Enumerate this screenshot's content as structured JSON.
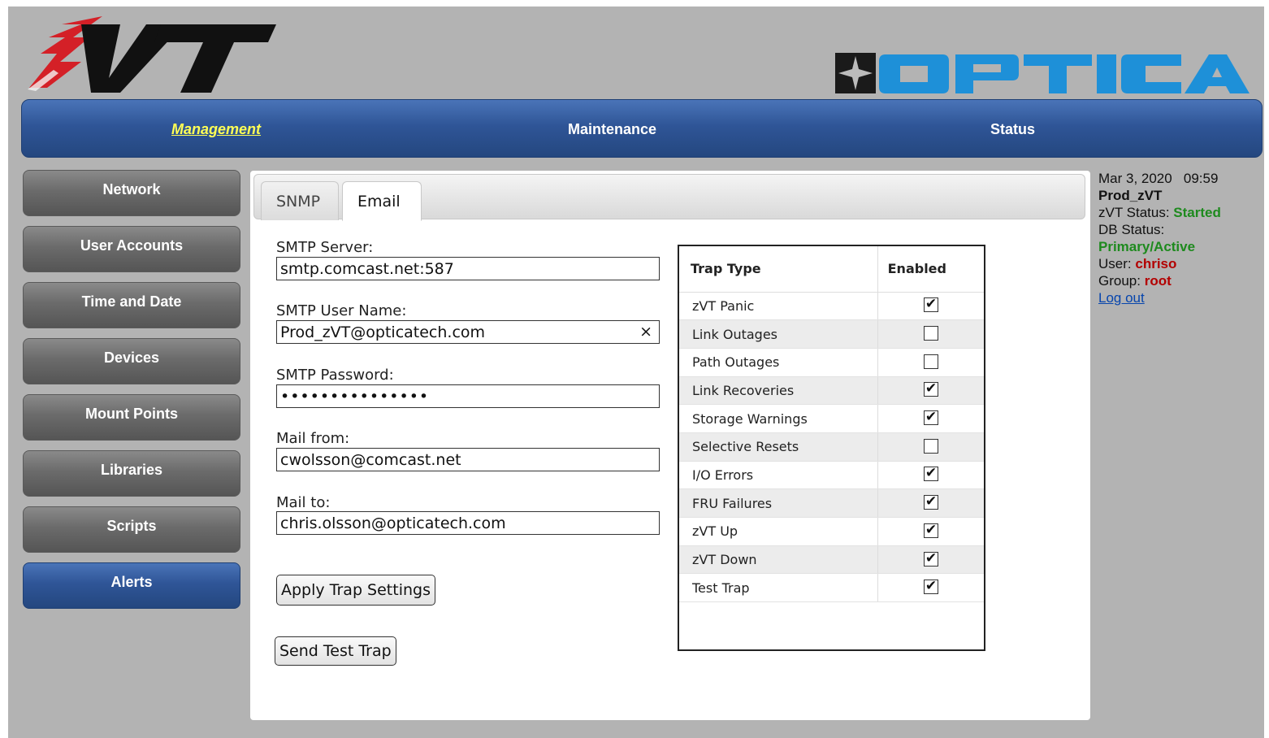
{
  "brand": {
    "product_logo": "zVT",
    "company_logo": "OPTICA",
    "colors": {
      "nav_blue": "#2f5597",
      "active_nav": "#ffff55",
      "logo_red": "#d42027",
      "optica_blue": "#1e90d8"
    }
  },
  "topnav": {
    "items": [
      {
        "label": "Management"
      },
      {
        "label": "Maintenance"
      },
      {
        "label": "Status"
      }
    ]
  },
  "sidebar": {
    "items": [
      {
        "label": "Network"
      },
      {
        "label": "User Accounts"
      },
      {
        "label": "Time and Date"
      },
      {
        "label": "Devices"
      },
      {
        "label": "Mount Points"
      },
      {
        "label": "Libraries"
      },
      {
        "label": "Scripts"
      },
      {
        "label": "Alerts"
      }
    ],
    "active": "Alerts"
  },
  "tabs": {
    "snmp": "SNMP",
    "email": "Email",
    "active": "Email"
  },
  "form": {
    "smtp_server_label": "SMTP Server:",
    "smtp_server_value": "smtp.comcast.net:587",
    "smtp_user_label": "SMTP User Name:",
    "smtp_user_value": "Prod_zVT@opticatech.com",
    "smtp_password_label": "SMTP Password:",
    "smtp_password_value": "•••••••••••••••",
    "mail_from_label": "Mail from:",
    "mail_from_value": "cwolsson@comcast.net",
    "mail_to_label": "Mail to:",
    "mail_to_value": "chris.olsson@opticatech.com",
    "clear_icon": "×",
    "apply_button": "Apply Trap Settings",
    "test_button": "Send Test Trap"
  },
  "traps": {
    "header_type": "Trap Type",
    "header_enabled": "Enabled",
    "rows": [
      {
        "name": "zVT Panic",
        "enabled": true
      },
      {
        "name": "Link Outages",
        "enabled": false
      },
      {
        "name": "Path Outages",
        "enabled": false
      },
      {
        "name": "Link Recoveries",
        "enabled": true
      },
      {
        "name": "Storage Warnings",
        "enabled": true
      },
      {
        "name": "Selective Resets",
        "enabled": false
      },
      {
        "name": "I/O Errors",
        "enabled": true
      },
      {
        "name": "FRU Failures",
        "enabled": true
      },
      {
        "name": "zVT Up",
        "enabled": true
      },
      {
        "name": "zVT Down",
        "enabled": true
      },
      {
        "name": "Test Trap",
        "enabled": true
      }
    ]
  },
  "status": {
    "datetime": "Mar 3, 2020   09:59",
    "system": "Prod_zVT",
    "zvt_status_label": "zVT Status:",
    "zvt_status_value": "Started",
    "db_status_label": "DB Status:",
    "db_status_value": "Primary/Active",
    "user_label": "User:",
    "user_value": "chriso",
    "group_label": "Group:",
    "group_value": "root",
    "logout": "Log out"
  }
}
